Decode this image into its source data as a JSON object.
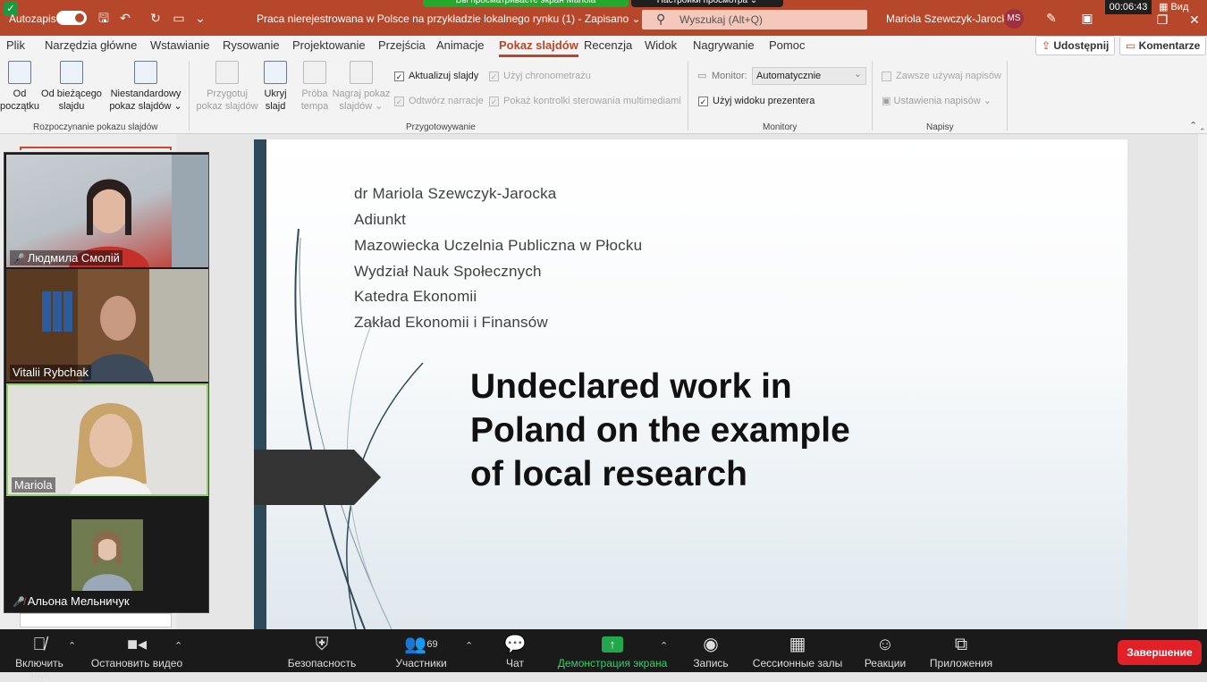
{
  "titlebar": {
    "autosave_label": "Autozapis",
    "doc_title": "Praca nierejestrowana w Polsce na przykładzie lokalnego rynku (1)  -  Zapisano  ⌄",
    "search_placeholder": "Wyszukaj (Alt+Q)",
    "user_name": "Mariola Szewczyk-Jarocka",
    "user_initials": "MS"
  },
  "zoom_top": {
    "banner": "Вы просматриваете экран Mariola",
    "options": "Настройки просмотра ⌄",
    "timer": "00:06:43",
    "view_label": "Вид"
  },
  "tabs": [
    "Plik",
    "Narzędzia główne",
    "Wstawianie",
    "Rysowanie",
    "Projektowanie",
    "Przejścia",
    "Animacje",
    "Pokaz slajdów",
    "Recenzja",
    "Widok",
    "Nagrywanie",
    "Pomoc"
  ],
  "active_tab": "Pokaz slajdów",
  "share_button": "Udostępnij",
  "comments_button": "Komentarze",
  "ribbon": {
    "from_start": [
      "Od",
      "początku"
    ],
    "from_current": [
      "Od bieżącego",
      "slajdu"
    ],
    "custom_show": [
      "Niestandardowy",
      "pokaz slajdów ⌄"
    ],
    "group_start": "Rozpoczynanie pokazu slajdów",
    "setup_show": [
      "Przygotuj",
      "pokaz slajdów"
    ],
    "hide_slide": [
      "Ukryj",
      "slajd"
    ],
    "rehearse": [
      "Próba",
      "tempa"
    ],
    "record": [
      "Nagraj pokaz",
      "slajdów ⌄"
    ],
    "update_slides": "Aktualizuj slajdy",
    "play_narration": "Odtwórz narracje",
    "use_timings": "Użyj chronometrażu",
    "show_media": "Pokaż kontrolki sterowania multimediami",
    "group_setup": "Przygotowywanie",
    "monitor_label": "Monitor:",
    "monitor_value": "Automatycznie",
    "presenter_view": "Użyj widoku prezentera",
    "group_monitors": "Monitory",
    "always_subtitles": "Zawsze używaj napisów",
    "subtitle_settings": "Ustawienia napisów ⌄",
    "group_subtitles": "Napisy"
  },
  "slide": {
    "author_lines": [
      "dr Mariola Szewczyk-Jarocka",
      "Adiunkt",
      "Mazowiecka Uczelnia Publiczna w Płocku",
      "Wydział Nauk Społecznych",
      "Katedra Ekonomii",
      "Zakład Ekonomii i Finansów"
    ],
    "title_lines": [
      "Undeclared work in",
      "Poland on the example",
      "of local research"
    ]
  },
  "participants": [
    {
      "name": "Людмила Смолій",
      "muted": true
    },
    {
      "name": "Vitalii Rybchak",
      "muted": false
    },
    {
      "name": "Mariola",
      "muted": false
    },
    {
      "name": "Альона Мельничук",
      "muted": true
    }
  ],
  "zoom_bar": {
    "mic": "Включить звук",
    "video": "Остановить видео",
    "security": "Безопасность",
    "participants": "Участники",
    "participants_count": "69",
    "chat": "Чат",
    "share": "Демонстрация экрана",
    "record": "Запись",
    "breakout": "Сессионные залы",
    "reactions": "Реакции",
    "apps": "Приложения",
    "end": "Завершение"
  }
}
